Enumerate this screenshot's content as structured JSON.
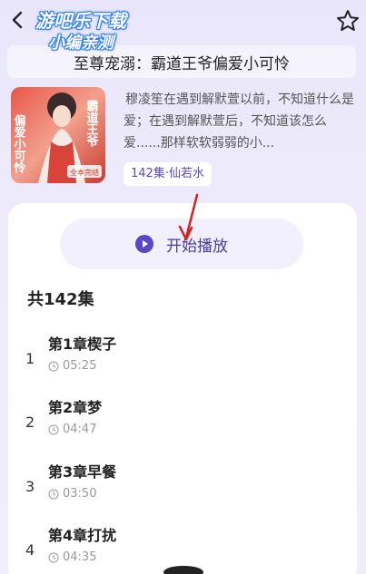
{
  "watermark": {
    "line1": "游吧乐下载",
    "line2": "小编亲测"
  },
  "book": {
    "title": "至尊宠溺：霸道王爷偏爱小可怜",
    "description": "穆凌笙在遇到解默萱以前，不知道什么是爱；在遇到解默萱后，不知道该怎么爱......那样软软弱弱的小...",
    "meta": "142集·仙若水",
    "cover_text_left": "偏爱小可怜",
    "cover_text_right": "霸道王爷",
    "cover_badge": "全本完结"
  },
  "play_button": {
    "label": "开始播放"
  },
  "episode_count": "共142集",
  "episodes": [
    {
      "num": "1",
      "title": "第1章楔子",
      "duration": "05:25"
    },
    {
      "num": "2",
      "title": "第2章梦",
      "duration": "04:47"
    },
    {
      "num": "3",
      "title": "第3章早餐",
      "duration": "03:50"
    },
    {
      "num": "4",
      "title": "第4章打扰",
      "duration": "04:35"
    }
  ],
  "colors": {
    "accent": "#5b47c6",
    "play_bg": "#f2f0fd",
    "arrow": "#d62020"
  },
  "icons": [
    "back-icon",
    "star-icon",
    "play-icon",
    "clock-icon"
  ]
}
